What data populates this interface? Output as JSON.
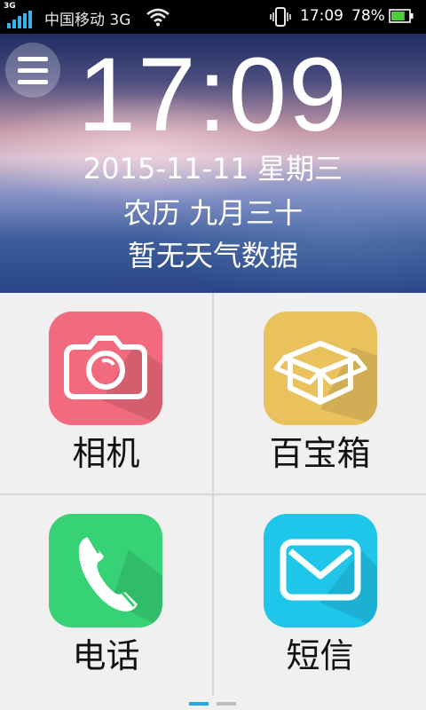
{
  "status_bar": {
    "network_type": "3G",
    "carrier": "中国移动 3G",
    "time": "17:09",
    "battery_percent": "78%",
    "battery_level": 0.78,
    "signal_color": "#35b2f0",
    "battery_color": "#4cd038"
  },
  "header": {
    "time": "17:09",
    "date": "2015-11-11  星期三",
    "lunar": "农历 九月三十",
    "weather": "暂无天气数据"
  },
  "apps": [
    {
      "label": "相机",
      "icon": "camera-icon",
      "color": "#f26a7e"
    },
    {
      "label": "百宝箱",
      "icon": "box-icon",
      "color": "#e9c25d"
    },
    {
      "label": "电话",
      "icon": "phone-icon",
      "color": "#37d275"
    },
    {
      "label": "短信",
      "icon": "mail-icon",
      "color": "#20c6ea"
    }
  ],
  "pager": {
    "page_count": 2,
    "current_page": 1,
    "active_color": "#2ba6de",
    "inactive_color": "#bdbdbd"
  }
}
